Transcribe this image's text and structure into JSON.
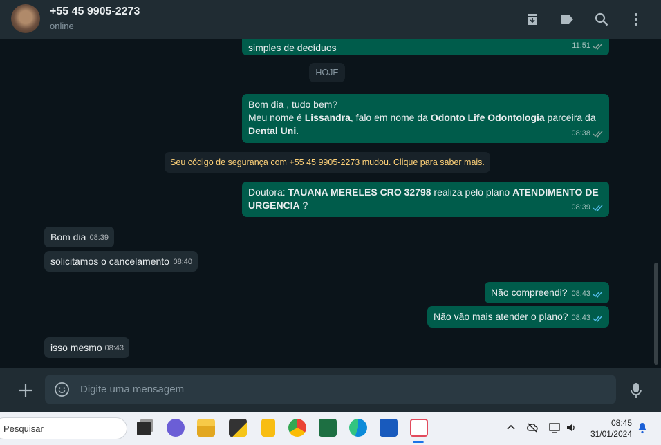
{
  "header": {
    "contact_name": "+55 45 9905-2273",
    "status": "online",
    "icons": [
      "archive-icon",
      "label-icon",
      "search-icon",
      "menu-icon"
    ]
  },
  "chat": {
    "messages": [
      {
        "dir": "out",
        "html_parts": [
          [
            {
              "t": "simples de decíduos"
            }
          ]
        ],
        "time": "11:51",
        "read": false
      },
      {
        "dir": "out",
        "html_parts": [
          [
            {
              "t": "Bom dia , tudo bem?"
            }
          ],
          [
            {
              "t": "Meu nome é "
            },
            {
              "t": "Lissandra",
              "b": true
            },
            {
              "t": ", falo em nome da "
            },
            {
              "t": "Odonto Life Odontologia",
              "b": true
            },
            {
              "t": " parceira da"
            }
          ],
          [
            {
              "t": "Dental Uni",
              "b": true
            },
            {
              "t": "."
            }
          ]
        ],
        "time": "08:38",
        "read": false
      },
      {
        "dir": "out",
        "html_parts": [
          [
            {
              "t": "Doutora: "
            },
            {
              "t": "TAUANA MERELES CRO 32798",
              "b": true
            },
            {
              "t": " realiza pelo plano "
            },
            {
              "t": "ATENDIMENTO DE",
              "b": true
            }
          ],
          [
            {
              "t": "URGENCIA",
              "b": true
            },
            {
              "t": "  ?"
            }
          ]
        ],
        "time": "08:39",
        "read": true
      },
      {
        "dir": "in",
        "text": "Bom dia",
        "time": "08:39"
      },
      {
        "dir": "in",
        "text": "solicitamos o cancelamento",
        "time": "08:40"
      },
      {
        "dir": "out",
        "text": "Não compreendi?",
        "time": "08:43",
        "read": true
      },
      {
        "dir": "out",
        "text": "Não vão mais atender o plano?",
        "time": "08:43",
        "read": true
      },
      {
        "dir": "in",
        "text": "isso mesmo",
        "time": "08:43"
      }
    ],
    "date_divider": "HOJE",
    "security_notice": "Seu código de segurança com +55 45 9905-2273 mudou. Clique para saber mais."
  },
  "composer": {
    "placeholder": "Digite uma mensagem",
    "icons": [
      "plus-icon",
      "emoji-icon",
      "mic-icon"
    ]
  },
  "taskbar": {
    "search_label": "Pesquisar",
    "apps": [
      "task-view",
      "teams",
      "file-explorer",
      "sticky-app",
      "keep",
      "chrome",
      "excel",
      "edge",
      "word",
      "snipping-tool"
    ],
    "time": "08:45",
    "date": "31/01/2024"
  },
  "colors": {
    "header_bg": "#202c33",
    "chat_bg": "#0b141a",
    "outgoing_bubble": "#005c4b",
    "incoming_bubble": "#202c33",
    "read_tick": "#53bdeb",
    "security_text": "#ffd279"
  }
}
